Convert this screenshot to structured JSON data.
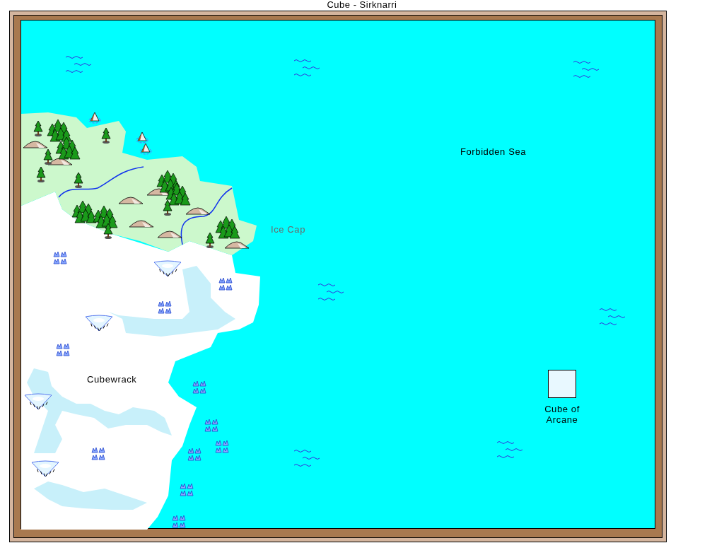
{
  "title": "Cube - Sirknarri",
  "labels": [
    {
      "text": "Forbidden Sea",
      "kind": "sea"
    },
    {
      "text": "Ice Cap",
      "kind": "region"
    },
    {
      "text": "Cubewrack",
      "kind": "place"
    },
    {
      "text": "Cube of Arcane",
      "kind": "site"
    }
  ]
}
